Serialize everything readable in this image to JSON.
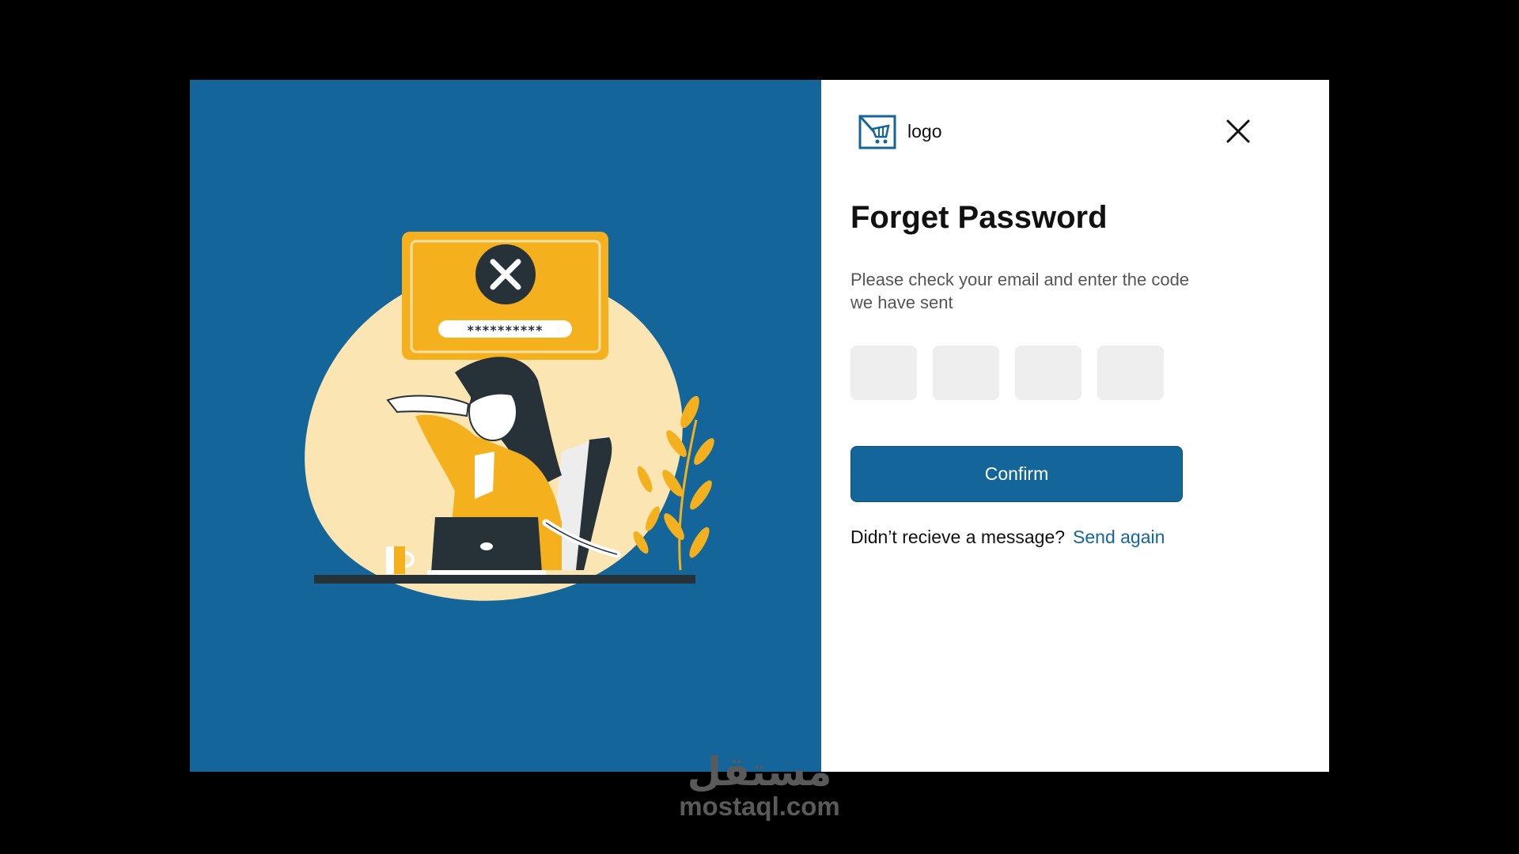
{
  "brand": {
    "logo_text": "logo"
  },
  "colors": {
    "primary": "#14669A",
    "accent": "#F5B11D",
    "blob": "#FBE6B3"
  },
  "illustration": {
    "masked_password": "**********"
  },
  "form": {
    "title": "Forget Password",
    "subtitle": "Please check your email and enter the code we have sent",
    "code_digits": [
      "",
      "",
      "",
      ""
    ],
    "confirm_label": "Confirm",
    "resend_prompt": "Didn’t recieve a message?",
    "resend_link": "Send again"
  },
  "watermark": {
    "arabic": "مستقل",
    "latin": "mostaql.com"
  }
}
